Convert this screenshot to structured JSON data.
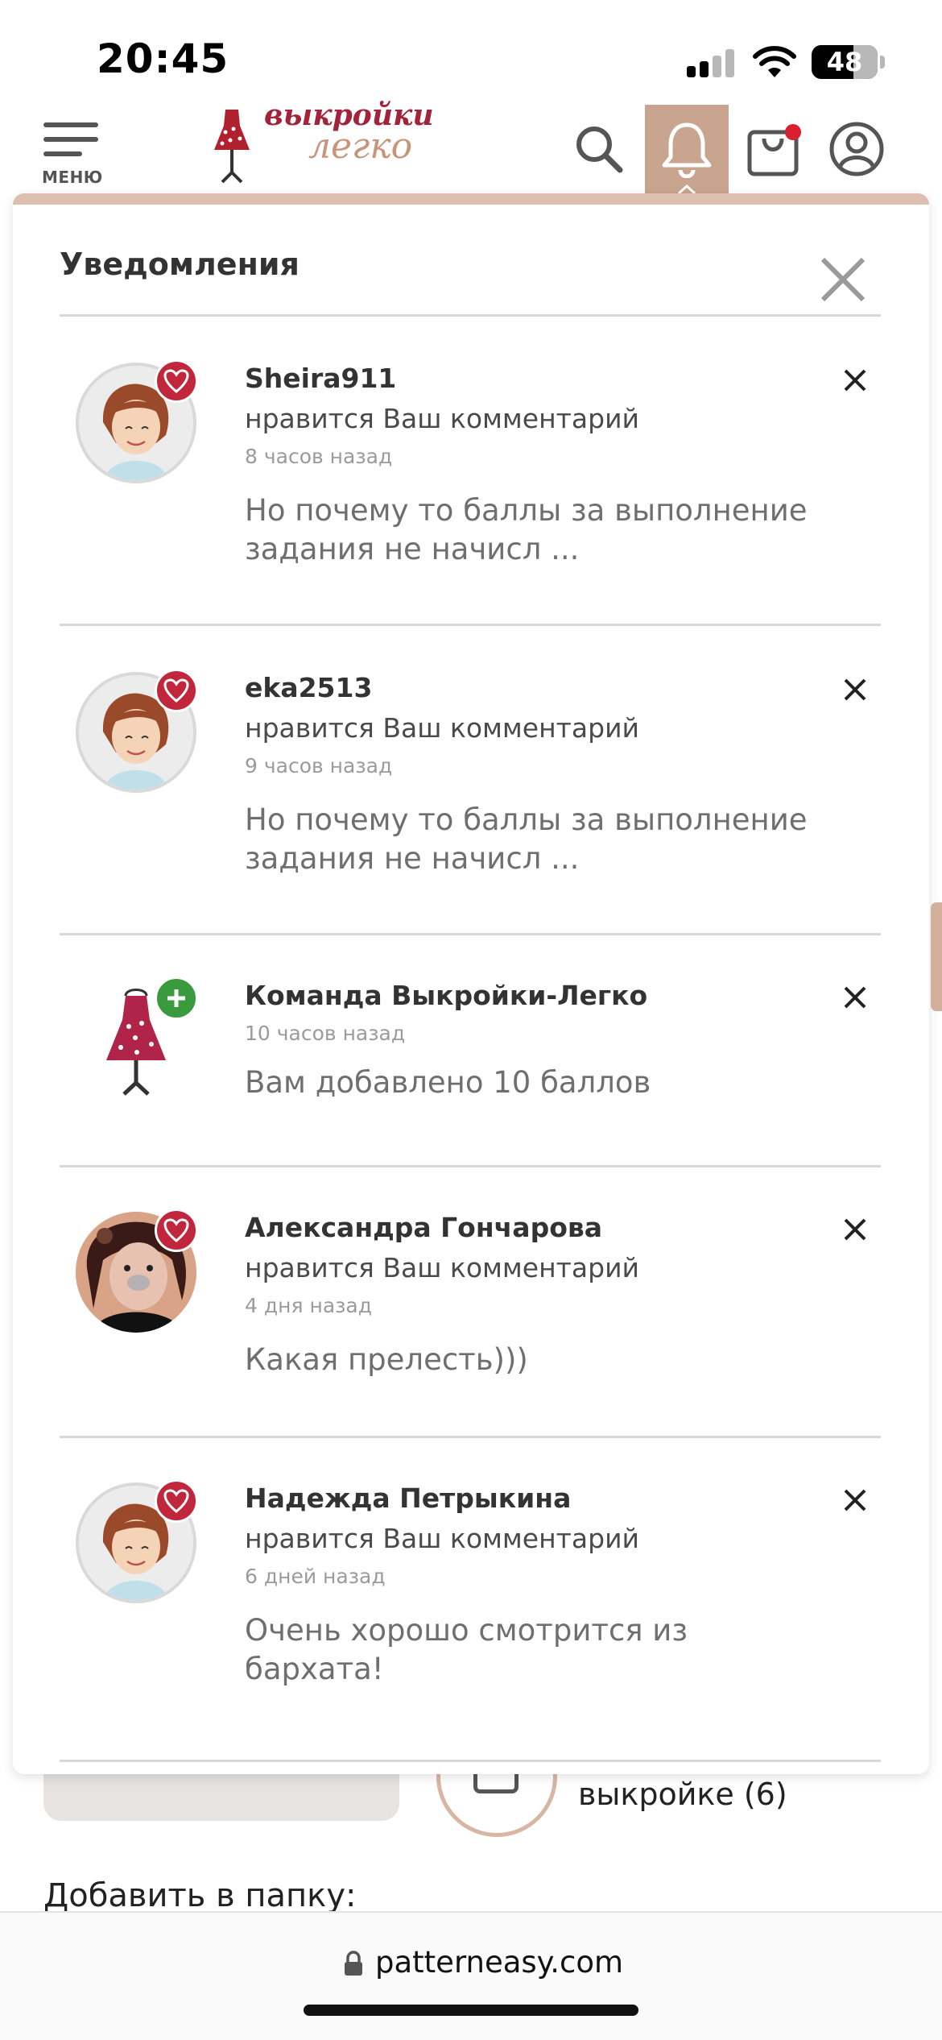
{
  "status_bar": {
    "time": "20:45",
    "battery": "48",
    "icons": [
      "signal-icon",
      "wifi-icon",
      "battery-icon"
    ]
  },
  "header": {
    "menu_label": "МЕНЮ",
    "logo_line1": "выкройки",
    "logo_line2": "легко",
    "icons": [
      "menu-icon",
      "search-icon",
      "bell-icon",
      "bag-icon",
      "user-icon"
    ],
    "accent": "#c9a48e"
  },
  "modal": {
    "title": "Уведомления",
    "close_icon": "close-icon",
    "notifications": [
      {
        "name": "Sheira911",
        "action": "нравится Ваш комментарий",
        "time": "8 часов назад",
        "body": "Но почему то баллы за выполнение задания не начисл ...",
        "avatar": "cartoon-avatar",
        "badge": "heart-icon"
      },
      {
        "name": "eka2513",
        "action": "нравится Ваш комментарий",
        "time": "9 часов назад",
        "body": "Но почему то баллы за выполнение задания не начисл ...",
        "avatar": "cartoon-avatar",
        "badge": "heart-icon"
      },
      {
        "name": "Команда Выкройки-Легко",
        "time": "10 часов назад",
        "body": "Вам добавлено 10 баллов",
        "avatar": "dress-logo",
        "badge": "plus-icon"
      },
      {
        "name": "Александра Гончарова",
        "action": "нравится Ваш комментарий",
        "time": "4 дня назад",
        "body": "Какая прелесть)))",
        "avatar": "photo-avatar",
        "badge": "heart-icon"
      },
      {
        "name": "Надежда Петрыкина",
        "action": "нравится Ваш комментарий",
        "time": "6 дней назад",
        "body": "Очень хорошо смотрится из бархата!",
        "avatar": "cartoon-avatar",
        "badge": "heart-icon"
      }
    ]
  },
  "background": {
    "pattern_text": "выкройке (6)",
    "add_folder": "Добавить в папку:"
  },
  "browser": {
    "url": "patterneasy.com"
  },
  "colors": {
    "heart_badge": "#c0273c",
    "plus_badge": "#3a9a3e",
    "modal_border": "#dcbfae"
  }
}
